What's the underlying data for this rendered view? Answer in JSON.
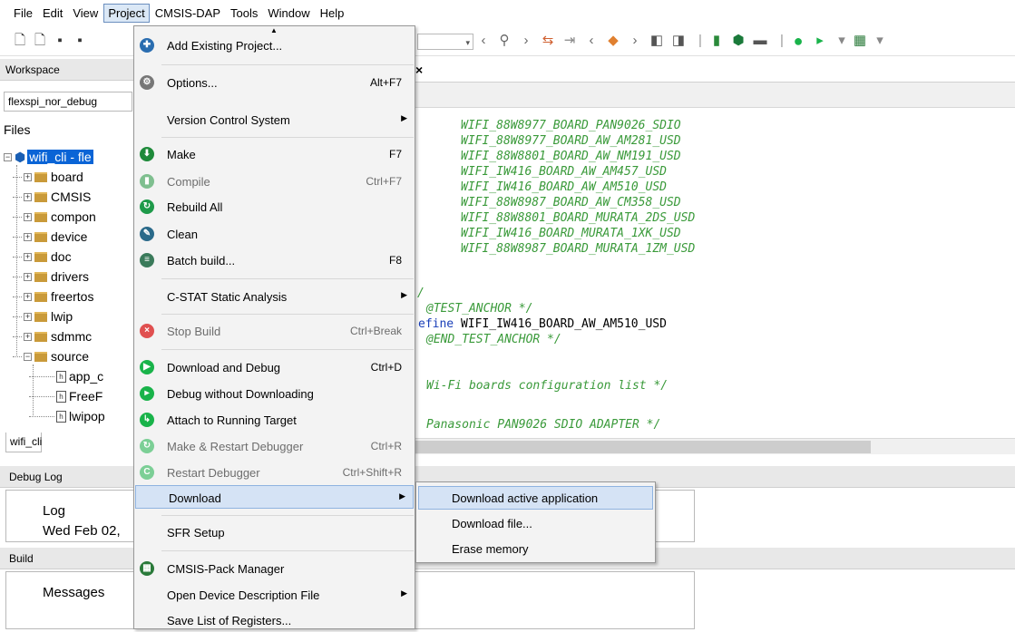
{
  "menubar": [
    "File",
    "Edit",
    "View",
    "Project",
    "CMSIS-DAP",
    "Tools",
    "Window",
    "Help"
  ],
  "workspace": {
    "title": "Workspace",
    "config": "flexspi_nor_debug",
    "files_label": "Files",
    "project": "wifi_cli - fle",
    "folders": [
      "board",
      "CMSIS",
      "compon",
      "device",
      "doc",
      "drivers",
      "freertos",
      "lwip",
      "sdmmc",
      "source"
    ],
    "source_files": [
      "app_c",
      "FreeF",
      "lwipop"
    ],
    "tab": "wifi_cli"
  },
  "editor": {
    "tab_close": "×",
    "lines": [
      {
        "text": "WIFI_88W8977_BOARD_PAN9026_SDIO",
        "cls": "cmt"
      },
      {
        "text": "WIFI_88W8977_BOARD_AW_AM281_USD",
        "cls": "cmt"
      },
      {
        "text": "WIFI_88W8801_BOARD_AW_NM191_USD",
        "cls": "cmt"
      },
      {
        "text": "WIFI_IW416_BOARD_AW_AM457_USD",
        "cls": "cmt"
      },
      {
        "text": "WIFI_IW416_BOARD_AW_AM510_USD",
        "cls": "cmt"
      },
      {
        "text": "WIFI_88W8987_BOARD_AW_CM358_USD",
        "cls": "cmt"
      },
      {
        "text": "WIFI_88W8801_BOARD_MURATA_2DS_USD",
        "cls": "cmt"
      },
      {
        "text": "WIFI_IW416_BOARD_MURATA_1XK_USD",
        "cls": "cmt"
      },
      {
        "text": "WIFI_88W8987_BOARD_MURATA_1ZM_USD",
        "cls": "cmt"
      },
      {
        "text": "/",
        "cls": "cmt"
      },
      {
        "text": "@TEST_ANCHOR */",
        "cls": "cmt"
      },
      {
        "text": "efine WIFI_IW416_BOARD_AW_AM510_USD",
        "cls": "mix"
      },
      {
        "text": "@END_TEST_ANCHOR */",
        "cls": "cmt"
      },
      {
        "text": "Wi-Fi boards configuration list */",
        "cls": "cmt"
      },
      {
        "text": "Panasonic PAN9026 SDIO ADAPTER */",
        "cls": "cmt"
      }
    ]
  },
  "debug_log": {
    "title": "Debug Log",
    "col": "Log",
    "row": "Wed Feb 02,"
  },
  "build": {
    "title": "Build",
    "col": "Messages"
  },
  "project_menu": {
    "items": [
      {
        "label": "Add Existing Project...",
        "shortcut": "",
        "icon": "add-project-icon"
      },
      {
        "label": "Options...",
        "shortcut": "Alt+F7",
        "icon": "gear-icon"
      },
      {
        "label": "Version Control System",
        "shortcut": "",
        "icon": ""
      },
      {
        "label": "Make",
        "shortcut": "F7",
        "icon": "make-icon"
      },
      {
        "label": "Compile",
        "shortcut": "Ctrl+F7",
        "icon": "compile-icon"
      },
      {
        "label": "Rebuild All",
        "shortcut": "",
        "icon": "rebuild-icon"
      },
      {
        "label": "Clean",
        "shortcut": "",
        "icon": "clean-icon"
      },
      {
        "label": "Batch build...",
        "shortcut": "F8",
        "icon": "batch-build-icon"
      },
      {
        "label": "C-STAT Static Analysis",
        "shortcut": "",
        "icon": ""
      },
      {
        "label": "Stop Build",
        "shortcut": "Ctrl+Break",
        "icon": "stop-icon"
      },
      {
        "label": "Download and Debug",
        "shortcut": "Ctrl+D",
        "icon": "debug-icon"
      },
      {
        "label": "Debug without Downloading",
        "shortcut": "",
        "icon": "play-icon"
      },
      {
        "label": "Attach to Running Target",
        "shortcut": "",
        "icon": "attach-icon"
      },
      {
        "label": "Make & Restart Debugger",
        "shortcut": "Ctrl+R",
        "icon": "make-restart-icon"
      },
      {
        "label": "Restart Debugger",
        "shortcut": "Ctrl+Shift+R",
        "icon": "restart-icon"
      },
      {
        "label": "Download",
        "shortcut": "",
        "icon": ""
      },
      {
        "label": "SFR Setup",
        "shortcut": "",
        "icon": ""
      },
      {
        "label": "CMSIS-Pack Manager",
        "shortcut": "",
        "icon": "cmsis-pack-icon"
      },
      {
        "label": "Open Device Description File",
        "shortcut": "",
        "icon": ""
      },
      {
        "label": "Save List of Registers...",
        "shortcut": "",
        "icon": ""
      }
    ]
  },
  "download_submenu": [
    "Download active application",
    "Download file...",
    "Erase memory"
  ]
}
